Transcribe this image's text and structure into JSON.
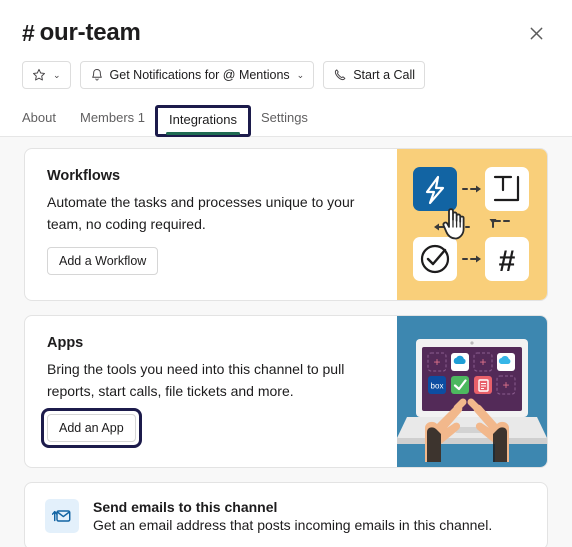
{
  "header": {
    "channel_prefix": "#",
    "channel_name": "our-team",
    "close_icon": "close-icon",
    "toolbar": {
      "star_icon": "star-icon",
      "star_caret": "⌄",
      "notifications_icon": "bell-icon",
      "notifications_label": "Get Notifications for @ Mentions",
      "notifications_caret": "⌄",
      "call_icon": "phone-icon",
      "call_label": "Start a Call"
    },
    "tabs": [
      {
        "label": "About",
        "active": false,
        "highlighted": false
      },
      {
        "label": "Members 1",
        "active": false,
        "highlighted": false
      },
      {
        "label": "Integrations",
        "active": true,
        "highlighted": true
      },
      {
        "label": "Settings",
        "active": false,
        "highlighted": false
      }
    ]
  },
  "colors": {
    "tab_underline": "#1f6b52",
    "highlight_box": "#1c1b4b",
    "workflow_panel_bg": "#f9cf7a",
    "workflow_tile_blue": "#1264a3",
    "apps_panel_bg": "#3d87b0",
    "laptop_screen": "#532a58",
    "email_icon_bg": "#e3f0fb",
    "email_icon_fg": "#1264a3",
    "page_bg": "#f8f8f8"
  },
  "cards": [
    {
      "id": "workflows",
      "title": "Workflows",
      "description": "Automate the tasks and processes unique to your team, no coding required.",
      "button_label": "Add a Workflow",
      "button_highlighted": false,
      "illustration": {
        "name": "workflow-builder-illustration",
        "tiles": [
          "bolt-icon",
          "text-box-icon",
          "check-circle-icon",
          "hash-icon"
        ],
        "cursor": "pointing-hand-cursor"
      }
    },
    {
      "id": "apps",
      "title": "Apps",
      "description": "Bring the tools you need into this channel to pull reports, start calls, file tickets and more.",
      "button_label": "Add an App",
      "button_highlighted": true,
      "illustration": {
        "name": "laptop-apps-illustration",
        "app_tiles": [
          "cloud-icon",
          "cloud-icon",
          "box-icon",
          "check-icon",
          "document-icon"
        ],
        "plus_slots": [
          "+",
          "+",
          "+"
        ]
      }
    }
  ],
  "email_row": {
    "icon": "email-forward-icon",
    "title": "Send emails to this channel",
    "subtitle": "Get an email address that posts incoming emails in this channel."
  }
}
